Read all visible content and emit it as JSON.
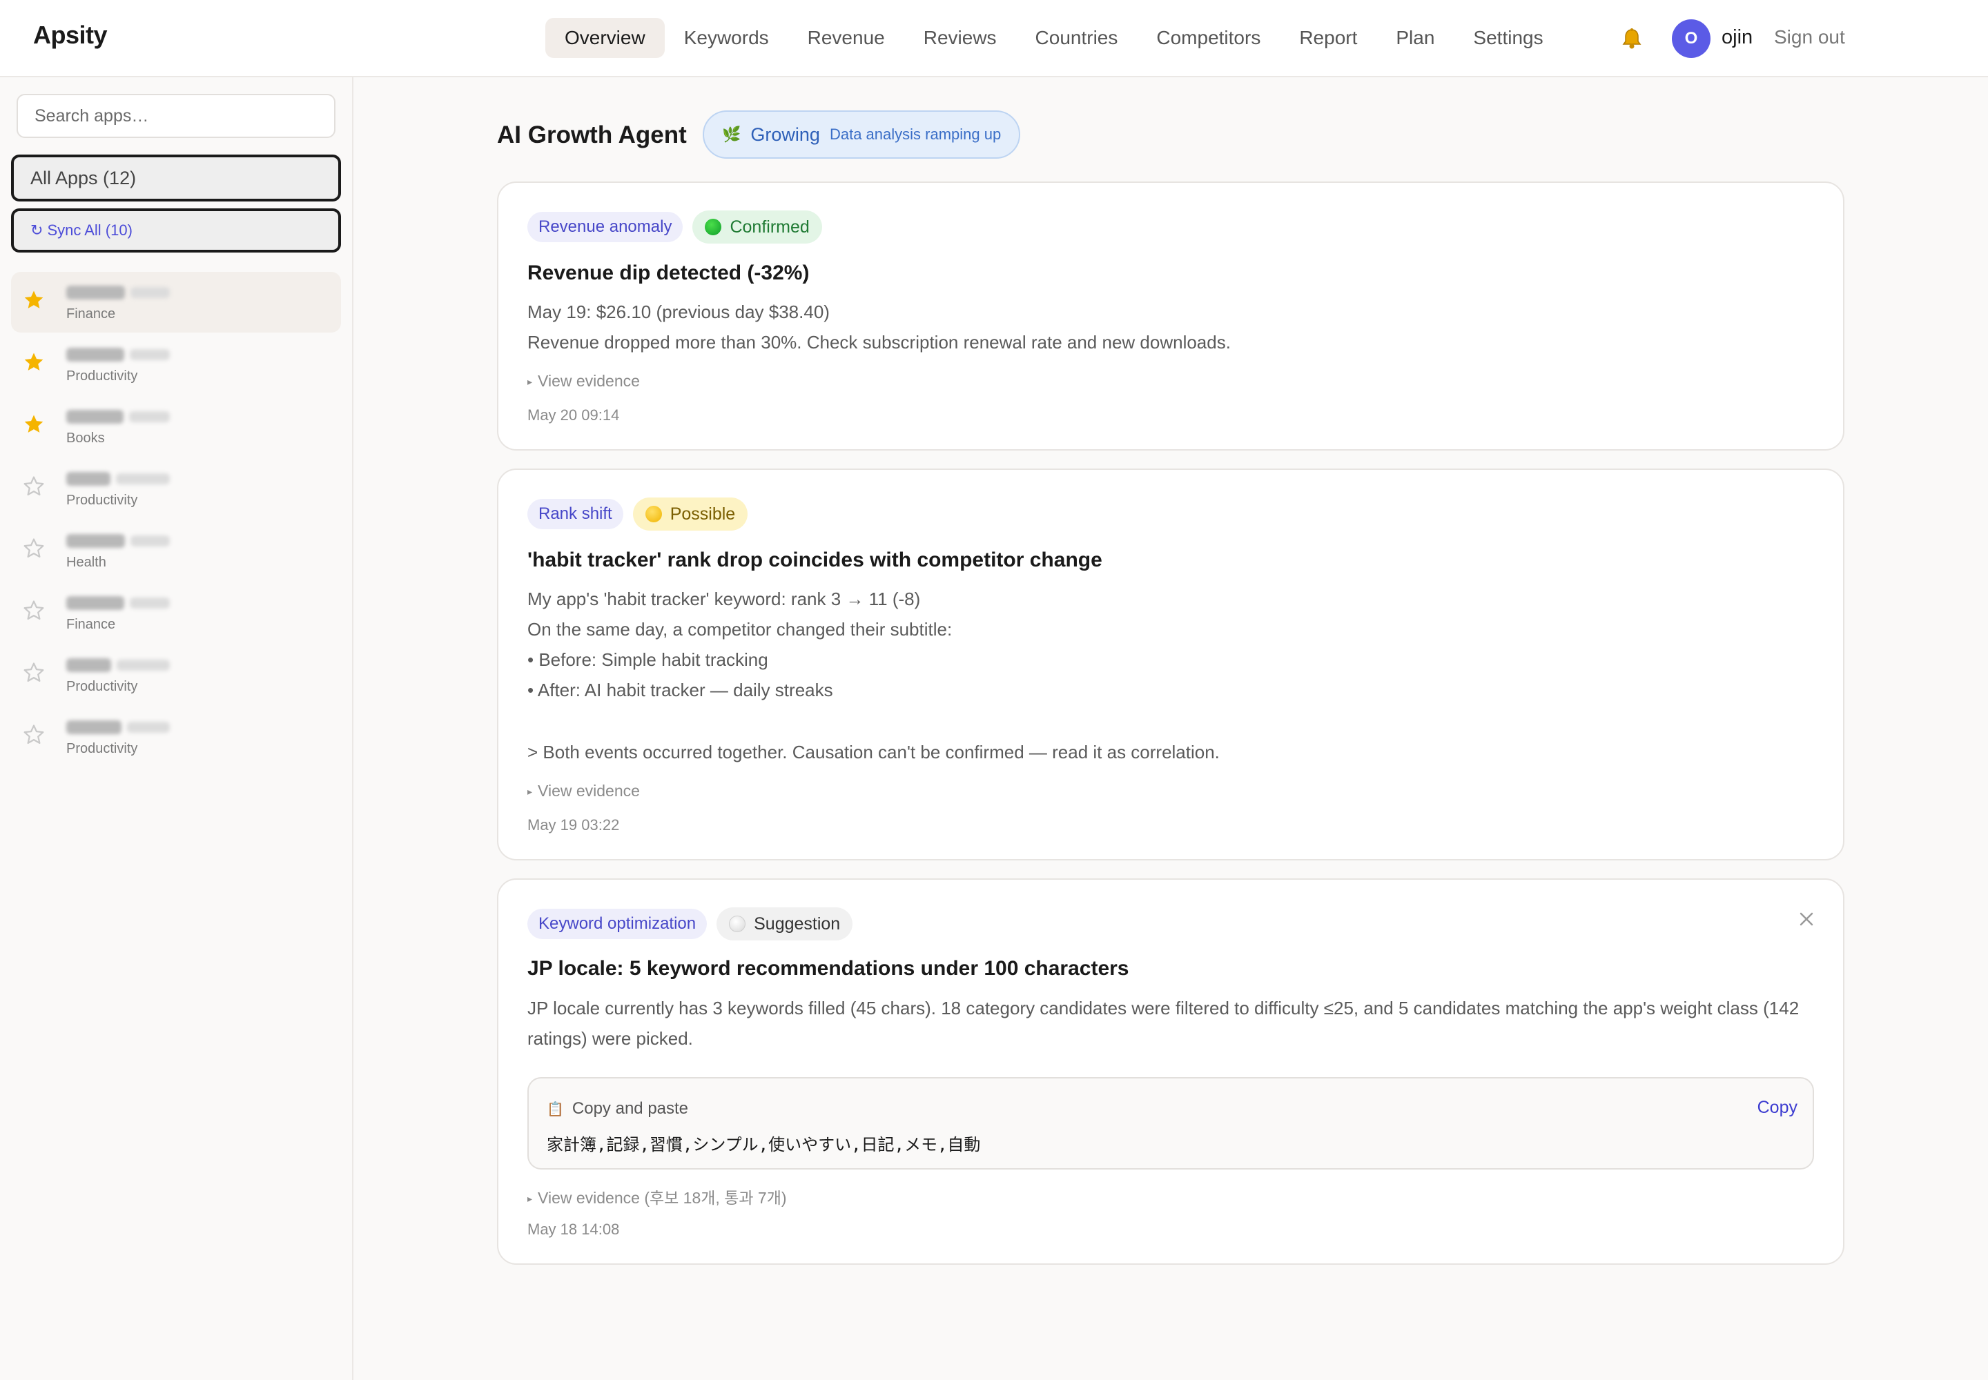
{
  "app": {
    "brand": "Apsity"
  },
  "nav": {
    "items": [
      "Overview",
      "Keywords",
      "Revenue",
      "Reviews",
      "Countries",
      "Competitors",
      "Report",
      "Plan",
      "Settings"
    ],
    "active": "Overview"
  },
  "user": {
    "initial": "O",
    "name": "ojin",
    "signout": "Sign out"
  },
  "sidebar": {
    "search_placeholder": "Search apps…",
    "all_apps": "All Apps (12)",
    "sync_all": "Sync All (10)",
    "sync_icon": "↻",
    "apps": [
      {
        "category": "Finance",
        "starred": true,
        "selected": true
      },
      {
        "category": "Productivity",
        "starred": true
      },
      {
        "category": "Books",
        "starred": true
      },
      {
        "category": "Productivity",
        "starred": false
      },
      {
        "category": "Health",
        "starred": false
      },
      {
        "category": "Finance",
        "starred": false
      },
      {
        "category": "Productivity",
        "starred": false
      },
      {
        "category": "Productivity",
        "starred": false
      }
    ]
  },
  "main": {
    "title": "AI Growth Agent",
    "status": {
      "icon": "🌿",
      "label": "Growing",
      "detail": "Data analysis ramping up"
    },
    "cards": [
      {
        "type": "Revenue anomaly",
        "status": "Confirmed",
        "title": "Revenue dip detected (-32%)",
        "lines": [
          "May 19: $26.10 (previous day $38.40)",
          "Revenue dropped more than 30%. Check subscription renewal rate and new downloads."
        ],
        "evidence": "View evidence",
        "timestamp": "May 20 09:14"
      },
      {
        "type": "Rank shift",
        "status": "Possible",
        "title": "'habit tracker' rank drop coincides with competitor change",
        "lines": [
          "My app's 'habit tracker' keyword: rank 3 → 11 (-8)",
          "On the same day, a competitor changed their subtitle:",
          "• Before: Simple habit tracking",
          "• After: AI habit tracker — daily streaks",
          "> Both events occurred together. Causation can't be confirmed — read it as correlation."
        ],
        "evidence": "View evidence",
        "timestamp": "May 19 03:22"
      },
      {
        "type": "Keyword optimization",
        "status": "Suggestion",
        "title": "JP locale: 5 keyword recommendations under 100 characters",
        "paragraph": "JP locale currently has 3 keywords filled (45 chars). 18 category candidates were filtered to difficulty ≤25, and 5 candidates matching the app's weight class (142 ratings) were picked.",
        "copy": {
          "icon": "📋",
          "label": "Copy and paste",
          "text": "家計簿,記録,習慣,シンプル,使いやすい,日記,メモ,自動",
          "button": "Copy"
        },
        "evidence": "View evidence (후보 18개, 통과 7개)",
        "timestamp": "May 18 14:08"
      }
    ]
  },
  "colors": {
    "accent": "#5b5be6",
    "star": "#f5b400",
    "confirmed": "#1f7a33",
    "possible": "#7a5e00"
  }
}
